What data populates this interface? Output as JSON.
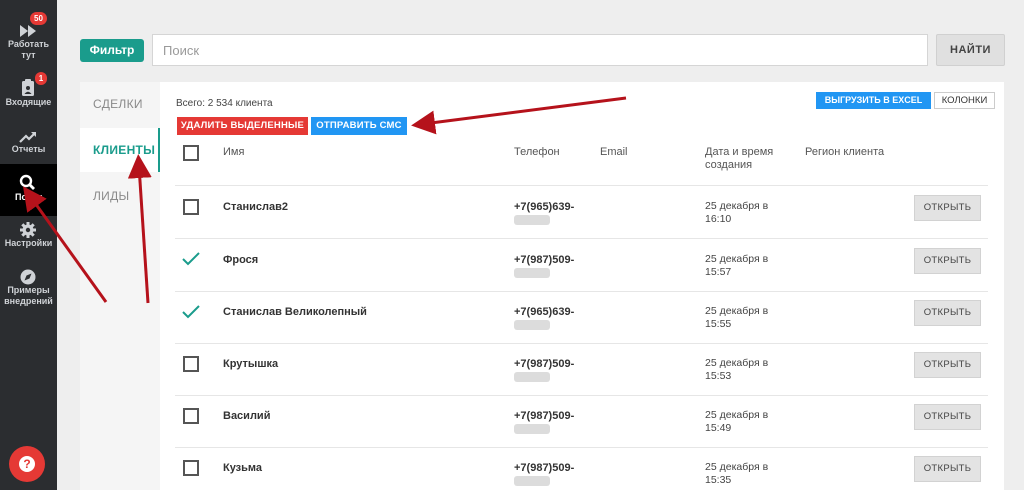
{
  "sidebar": {
    "items": [
      {
        "label": "Работать тут",
        "badge": "50"
      },
      {
        "label": "Входящие",
        "badge": "1"
      },
      {
        "label": "Отчеты"
      },
      {
        "label": "Поиск"
      },
      {
        "label": "Настройки"
      },
      {
        "label": "Примеры внедрений"
      }
    ],
    "help": "?"
  },
  "search": {
    "filter_label": "Фильтр",
    "placeholder": "Поиск",
    "value": "",
    "find_label": "НАЙТИ"
  },
  "tabs": [
    {
      "label": "СДЕЛКИ"
    },
    {
      "label": "КЛИЕНТЫ",
      "active": true
    },
    {
      "label": "ЛИДЫ"
    }
  ],
  "toolbar": {
    "total": "Всего: 2 534 клиента",
    "delete_label": "УДАЛИТЬ ВЫДЕЛЕННЫЕ",
    "sms_label": "ОТПРАВИТЬ СМС",
    "excel_label": "ВЫГРУЗИТЬ В EXCEL",
    "columns_label": "КОЛОНКИ"
  },
  "table": {
    "headers": {
      "name": "Имя",
      "phone": "Телефон",
      "email": "Email",
      "date_line1": "Дата и время",
      "date_line2": "создания",
      "region": "Регион клиента"
    },
    "open_label": "ОТКРЫТЬ",
    "rows": [
      {
        "name": "Станислав2",
        "phone": "+7(965)639-",
        "date_line1": "25 декабря в",
        "date_line2": "16:10",
        "checked": false
      },
      {
        "name": "Фрося",
        "phone": "+7(987)509-",
        "date_line1": "25 декабря в",
        "date_line2": "15:57",
        "checked": true
      },
      {
        "name": "Станислав Великолепный",
        "phone": "+7(965)639-",
        "date_line1": "25 декабря в",
        "date_line2": "15:55",
        "checked": true
      },
      {
        "name": "Крутышка",
        "phone": "+7(987)509-",
        "date_line1": "25 декабря в",
        "date_line2": "15:53",
        "checked": false
      },
      {
        "name": "Василий",
        "phone": "+7(987)509-",
        "date_line1": "25 декабря в",
        "date_line2": "15:49",
        "checked": false
      },
      {
        "name": "Кузьма",
        "phone": "+7(987)509-",
        "date_line1": "25 декабря в",
        "date_line2": "15:35",
        "checked": false
      }
    ]
  },
  "colors": {
    "accent": "#1a9c8c",
    "danger": "#e53935",
    "primary": "#2196f3",
    "sidebar": "#2b2d30",
    "annotation": "#b5121b"
  }
}
